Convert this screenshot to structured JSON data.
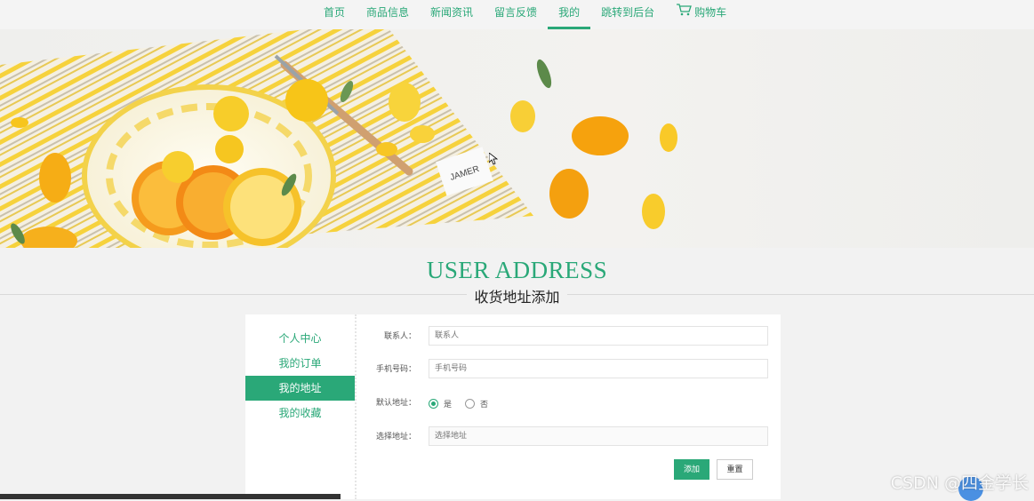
{
  "nav": {
    "items": [
      {
        "label": "首页",
        "active": false
      },
      {
        "label": "商品信息",
        "active": false
      },
      {
        "label": "新闻资讯",
        "active": false
      },
      {
        "label": "留言反馈",
        "active": false
      },
      {
        "label": "我的",
        "active": true
      },
      {
        "label": "跳转到后台",
        "active": false
      },
      {
        "label": "购物车",
        "active": false,
        "icon": "cart-icon"
      }
    ]
  },
  "banner": {
    "tag_text": "JAMER"
  },
  "section": {
    "title_en": "USER ADDRESS",
    "title_cn": "收货地址添加"
  },
  "sidebar": {
    "items": [
      {
        "label": "个人中心",
        "active": false
      },
      {
        "label": "我的订单",
        "active": false
      },
      {
        "label": "我的地址",
        "active": true
      },
      {
        "label": "我的收藏",
        "active": false
      }
    ]
  },
  "form": {
    "contact": {
      "label": "联系人：",
      "placeholder": "联系人",
      "value": ""
    },
    "phone": {
      "label": "手机号码：",
      "placeholder": "手机号码",
      "value": ""
    },
    "default": {
      "label": "默认地址：",
      "options": [
        "是",
        "否"
      ],
      "selected": "是"
    },
    "address": {
      "label": "选择地址：",
      "placeholder": "选择地址",
      "value": ""
    },
    "add_label": "添加",
    "reset_label": "重置"
  },
  "watermark": "CSDN @四金学长",
  "colors": {
    "accent": "#2aa878",
    "background": "#f2f2f2"
  }
}
